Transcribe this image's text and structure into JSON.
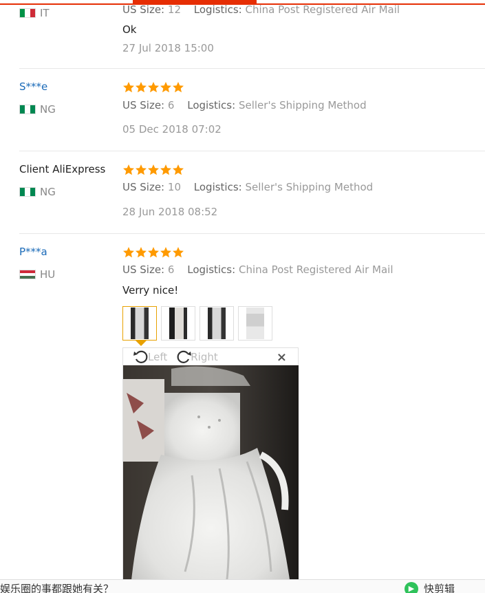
{
  "reviews": [
    {
      "user": "",
      "country": "IT",
      "us_size_label": "US Size:",
      "us_size": "12",
      "logistics_label": "Logistics:",
      "logistics": "China Post Registered Air Mail",
      "comment": "Ok",
      "date": "27 Jul 2018 15:00"
    },
    {
      "user": "S***e",
      "country": "NG",
      "rating": 5,
      "us_size_label": "US Size:",
      "us_size": "6",
      "logistics_label": "Logistics:",
      "logistics": "Seller's Shipping Method",
      "date": "05 Dec 2018 07:02"
    },
    {
      "user": "Client AliExpress",
      "country": "NG",
      "rating": 5,
      "us_size_label": "US Size:",
      "us_size": "10",
      "logistics_label": "Logistics:",
      "logistics": "Seller's Shipping Method",
      "date": "28 Jun 2018 08:52"
    },
    {
      "user": "P***a",
      "country": "HU",
      "rating": 5,
      "us_size_label": "US Size:",
      "us_size": "6",
      "logistics_label": "Logistics:",
      "logistics": "China Post Registered Air Mail",
      "comment": "Verry nice!",
      "photos_count": 4
    }
  ],
  "viewer": {
    "rotate_left": "Left",
    "rotate_right": "Right",
    "close": "×"
  },
  "bottom_bar": {
    "text": "娱乐圈的事都跟她有关？",
    "right_text": "快剪辑"
  },
  "colors": {
    "accent": "#e62e04",
    "star": "#ff9a00",
    "link": "#1a6ab8",
    "muted": "#999999"
  }
}
